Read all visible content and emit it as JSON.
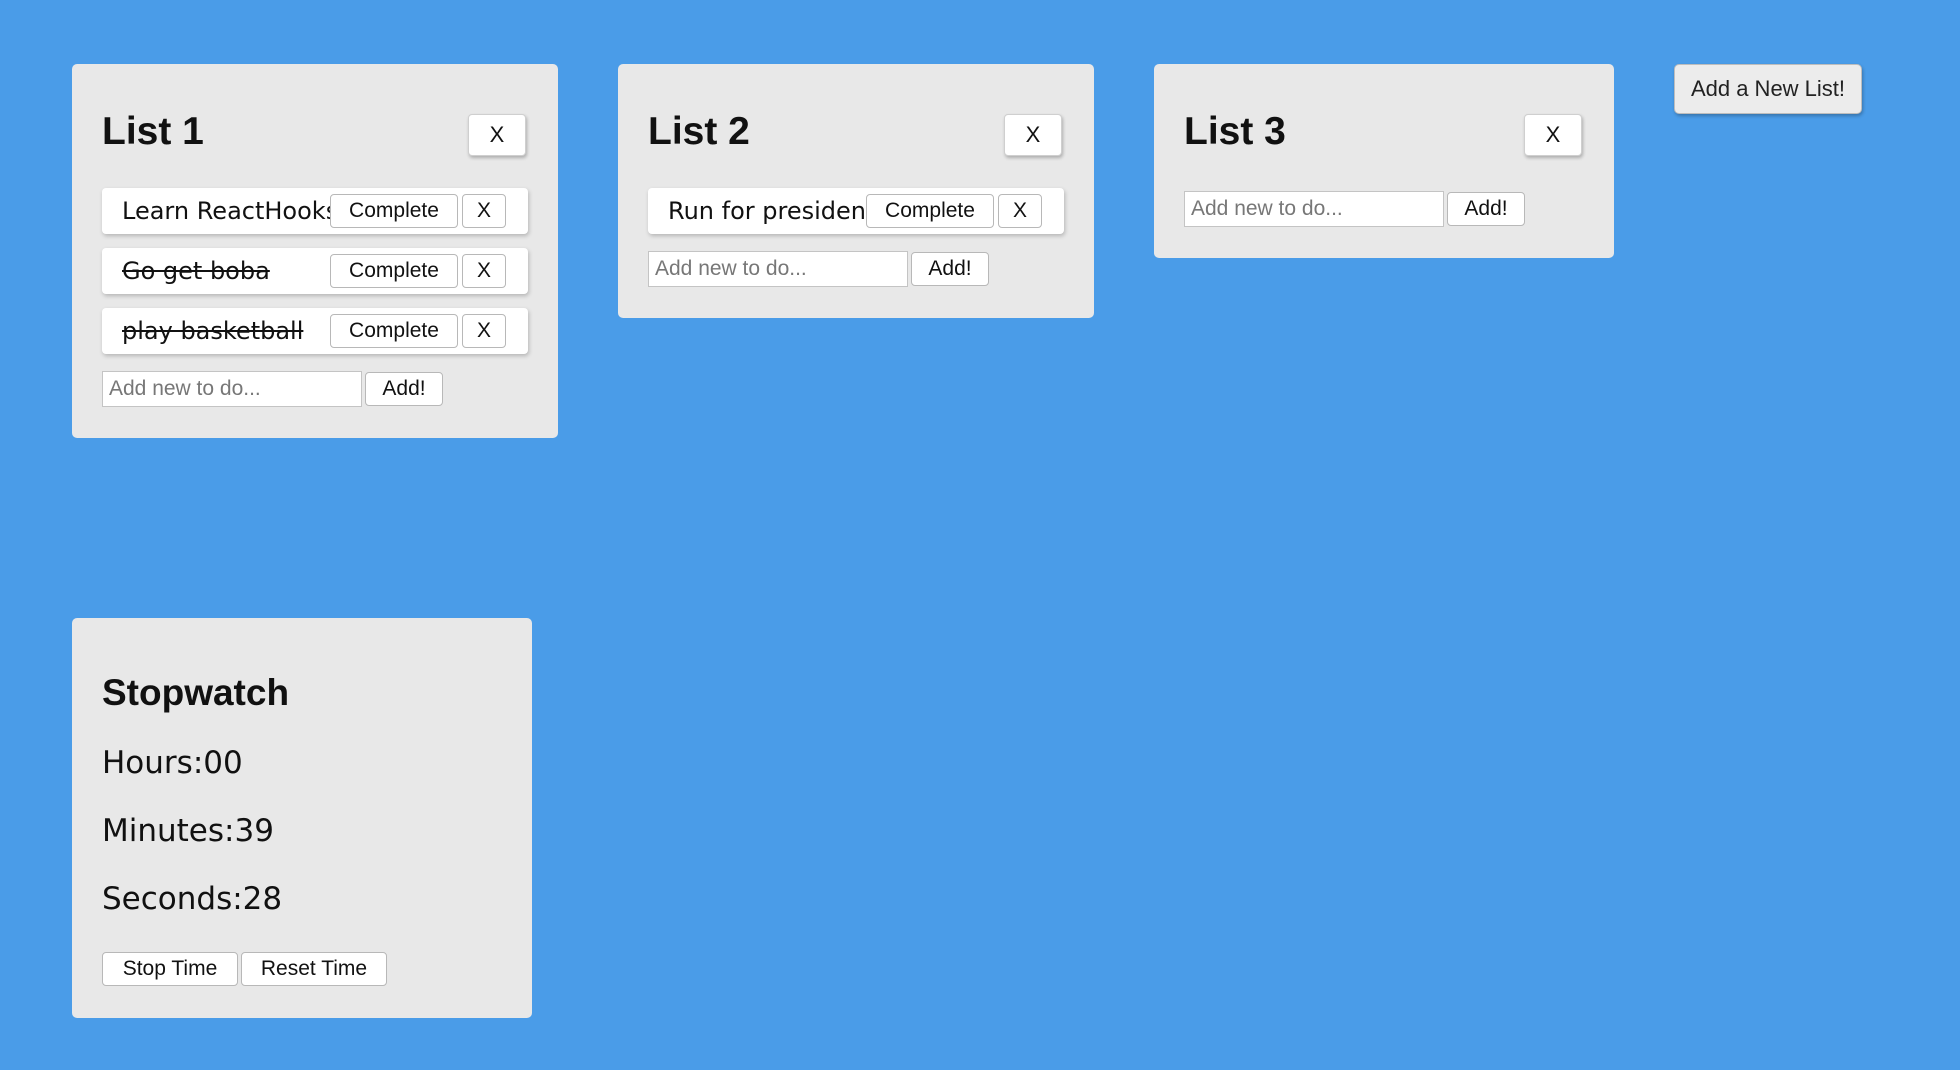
{
  "add_list_button": "Add a New List!",
  "lists": [
    {
      "title": "List 1",
      "close_label": "X",
      "todos": [
        {
          "text": "Learn ReactHooks",
          "completed": false,
          "complete_label": "Complete",
          "remove_label": "X"
        },
        {
          "text": "Go get boba",
          "completed": true,
          "complete_label": "Complete",
          "remove_label": "X"
        },
        {
          "text": "play basketball",
          "completed": true,
          "complete_label": "Complete",
          "remove_label": "X"
        }
      ],
      "input_placeholder": "Add new to do...",
      "add_label": "Add!"
    },
    {
      "title": "List 2",
      "close_label": "X",
      "todos": [
        {
          "text": "Run for president",
          "completed": false,
          "complete_label": "Complete",
          "remove_label": "X"
        }
      ],
      "input_placeholder": "Add new to do...",
      "add_label": "Add!"
    },
    {
      "title": "List 3",
      "close_label": "X",
      "todos": [],
      "input_placeholder": "Add new to do...",
      "add_label": "Add!"
    }
  ],
  "stopwatch": {
    "title": "Stopwatch",
    "hours": "Hours:00",
    "minutes": "Minutes:39",
    "seconds": "Seconds:28",
    "stop_label": "Stop Time",
    "reset_label": "Reset Time"
  }
}
